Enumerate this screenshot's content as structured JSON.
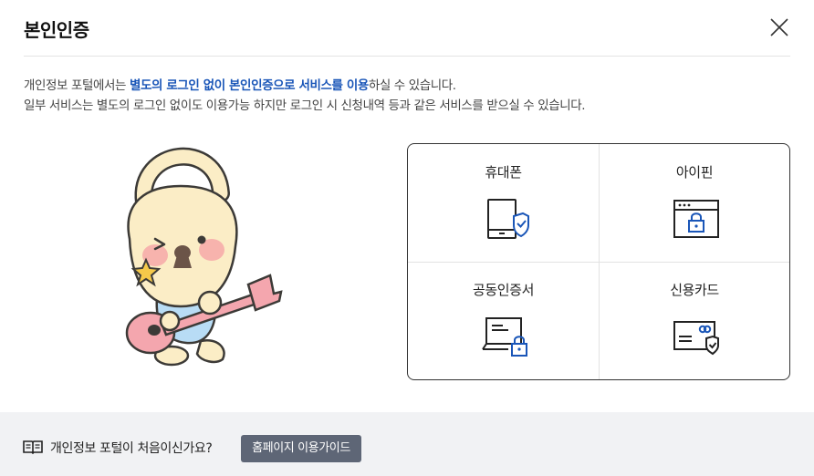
{
  "modal": {
    "title": "본인인증",
    "close_label": "close"
  },
  "description": {
    "line1_prefix": "개인정보 포털에서는 ",
    "line1_highlight": "별도의 로그인 없이 본인인증으로 서비스를 이용",
    "line1_suffix": "하실 수 있습니다.",
    "line2": "일부 서비스는 별도의 로그인 없이도 이용가능 하지만 로그인 시 신청내역 등과 같은 서비스를 받으실 수 있습니다."
  },
  "auth_methods": [
    {
      "label": "휴대폰",
      "icon": "mobile-phone-shield-icon"
    },
    {
      "label": "아이핀",
      "icon": "browser-lock-icon"
    },
    {
      "label": "공동인증서",
      "icon": "laptop-lock-icon"
    },
    {
      "label": "신용카드",
      "icon": "credit-card-shield-icon"
    }
  ],
  "footer": {
    "question": "개인정보 포털이 처음이신가요?",
    "guide_button": "홈페이지 이용가이드",
    "icon": "book-icon"
  },
  "colors": {
    "highlight": "#1a56b8",
    "footer_bg": "#f1f2f4",
    "button_bg": "#5e6676",
    "icon_accent": "#1a56b8"
  }
}
